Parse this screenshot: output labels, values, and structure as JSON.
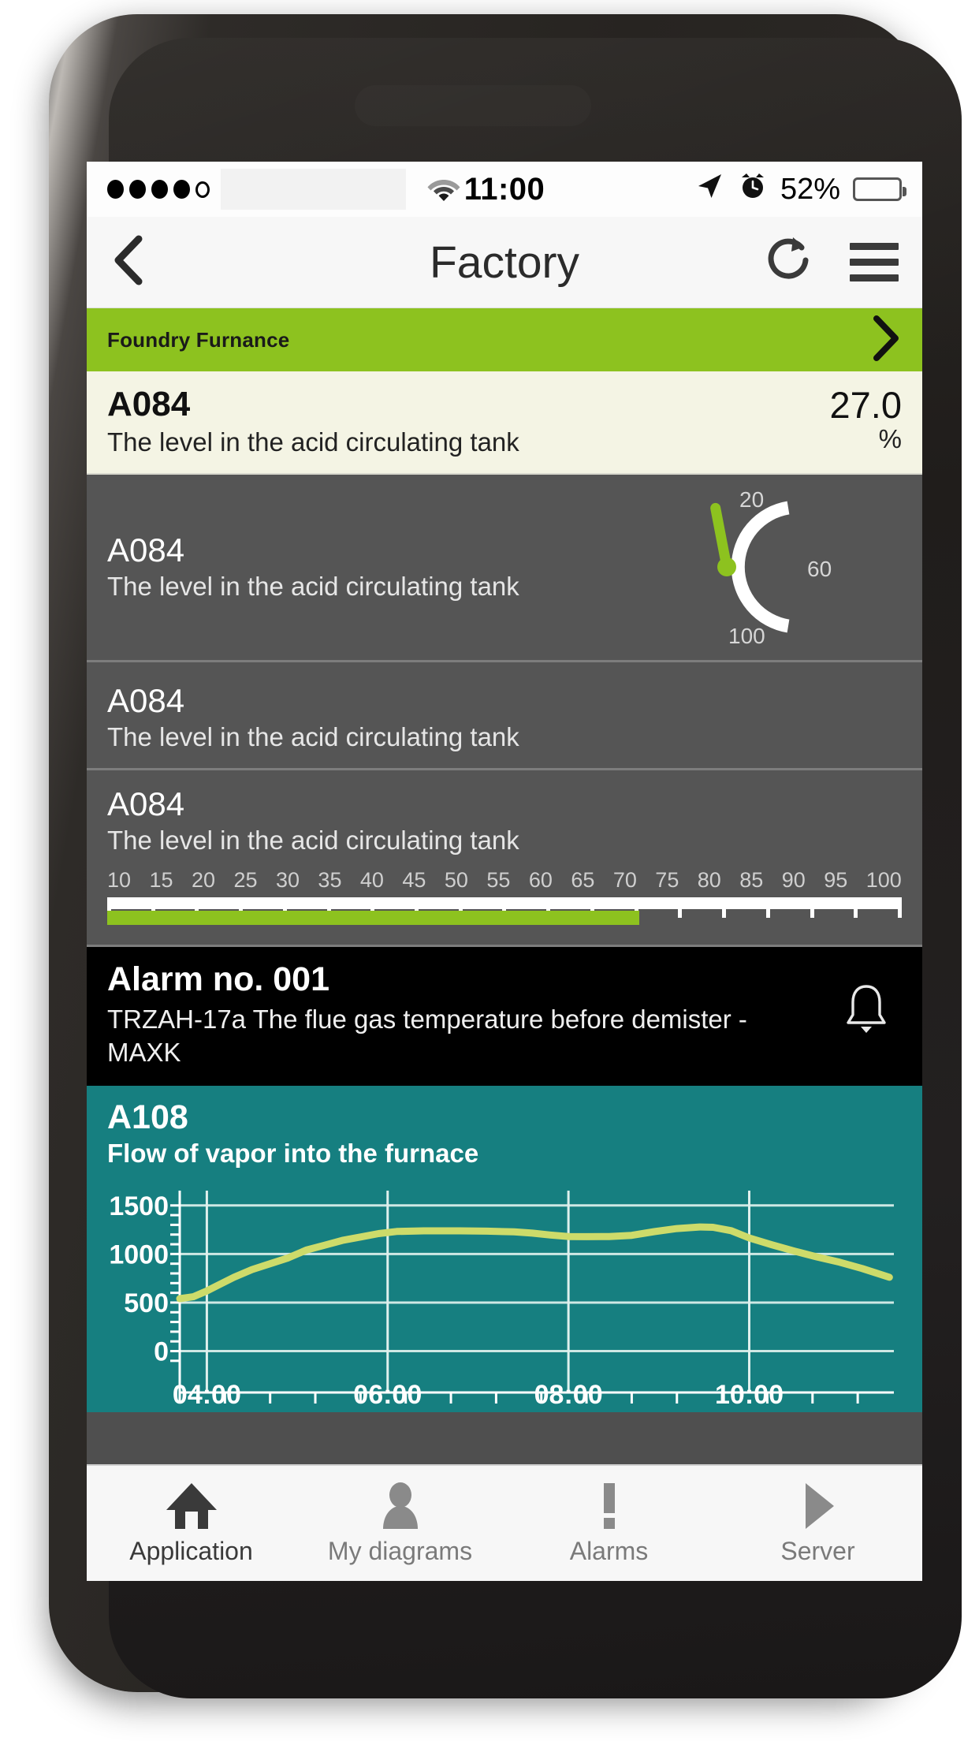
{
  "status_bar": {
    "signal_dots_filled": 4,
    "signal_dots_total": 5,
    "wifi_icon": "wifi-icon",
    "time": "11:00",
    "location_icon": "location-arrow-icon",
    "alarm_icon": "alarm-clock-icon",
    "battery_percent_label": "52%",
    "battery_level": 52
  },
  "navbar": {
    "back_icon": "chevron-left-icon",
    "title": "Factory",
    "refresh_icon": "refresh-icon",
    "menu_icon": "hamburger-menu-icon"
  },
  "group": {
    "label": "Foundry Furnance",
    "chevron_icon": "chevron-right-icon",
    "color": "#8dc21f"
  },
  "cards": {
    "value_card": {
      "code": "A084",
      "description": "The level in the acid circulating tank",
      "value": "27.0",
      "unit": "%",
      "background": "#f4f4e4"
    },
    "gauge_card": {
      "code": "A084",
      "description": "The level in the acid circulating tank",
      "gauge": {
        "labels": [
          "20",
          "60",
          "100"
        ],
        "min": 0,
        "max": 120,
        "needle_value": 55,
        "needle_color": "#8dc21f",
        "arc_color": "#ffffff"
      },
      "background": "#555555"
    },
    "plain_card": {
      "code": "A084",
      "description": "The level in the acid circulating tank",
      "background": "#555555"
    },
    "scale_card": {
      "code": "A084",
      "description": "The level in the acid circulating tank",
      "ticks": [
        "10",
        "15",
        "20",
        "25",
        "30",
        "35",
        "40",
        "45",
        "50",
        "55",
        "60",
        "65",
        "70",
        "75",
        "80",
        "85",
        "90",
        "95",
        "100"
      ],
      "fill_percent": 67,
      "fill_color": "#8dc21f",
      "background": "#555555"
    },
    "alarm_card": {
      "title": "Alarm no. 001",
      "text": "TRZAH-17a The flue gas temperature before demister - MAXK",
      "bell_icon": "bell-icon",
      "background": "#000000"
    },
    "chart_card": {
      "code": "A108",
      "description": "Flow of vapor into the furnace",
      "background": "#167f80"
    }
  },
  "chart_data": {
    "type": "line",
    "title": "Flow of vapor into the furnace",
    "series_name": "A108",
    "line_color": "#cddb6a",
    "background": "#167f80",
    "grid": true,
    "legend": "none",
    "xlabel": "",
    "ylabel": "",
    "ylim": [
      -150,
      1620
    ],
    "yticks": [
      0,
      500,
      1000,
      1500
    ],
    "ytick_labels": [
      "0",
      "500",
      "1000",
      "1500"
    ],
    "xticks": [
      "04:00",
      "06:00",
      "08:00",
      "10:00"
    ],
    "xlim_hours": [
      3.7,
      11.6
    ],
    "x": [
      3.7,
      3.85,
      4.0,
      4.15,
      4.3,
      4.5,
      4.7,
      4.9,
      5.1,
      5.3,
      5.5,
      5.7,
      5.9,
      6.1,
      6.4,
      6.8,
      7.1,
      7.4,
      7.6,
      7.8,
      8.0,
      8.2,
      8.45,
      8.7,
      8.95,
      9.2,
      9.45,
      9.6,
      9.8,
      10.0,
      10.25,
      10.5,
      10.75,
      11.0,
      11.25,
      11.55
    ],
    "y": [
      540,
      560,
      620,
      690,
      760,
      840,
      900,
      960,
      1040,
      1090,
      1140,
      1175,
      1210,
      1232,
      1238,
      1238,
      1235,
      1228,
      1215,
      1195,
      1180,
      1178,
      1180,
      1192,
      1230,
      1262,
      1278,
      1275,
      1240,
      1165,
      1095,
      1030,
      970,
      915,
      850,
      760
    ]
  },
  "tabbar": {
    "items": [
      {
        "label": "Application",
        "icon": "home-icon",
        "active": true
      },
      {
        "label": "My diagrams",
        "icon": "person-icon",
        "active": false
      },
      {
        "label": "Alarms",
        "icon": "exclamation-icon",
        "active": false
      },
      {
        "label": "Server",
        "icon": "play-icon",
        "active": false
      }
    ]
  }
}
